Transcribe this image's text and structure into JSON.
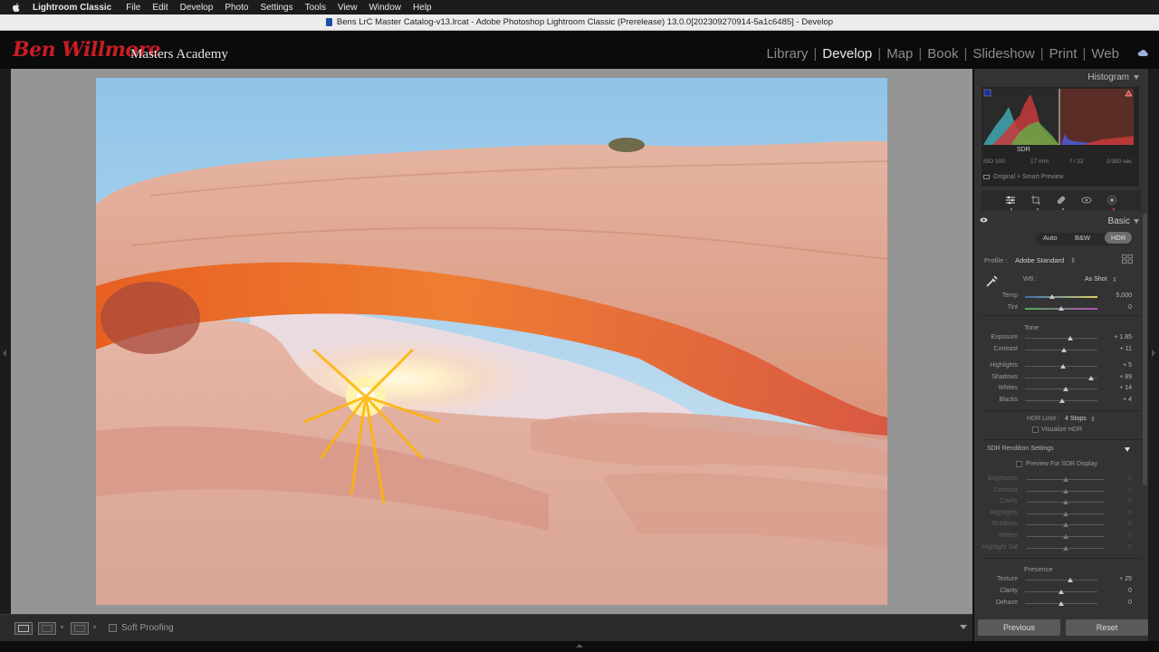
{
  "menubar": {
    "app_name": "Lightroom Classic",
    "items": [
      "File",
      "Edit",
      "Develop",
      "Photo",
      "Settings",
      "Tools",
      "View",
      "Window",
      "Help"
    ]
  },
  "window": {
    "title": "Bens LrC Master Catalog-v13.lrcat - Adobe Photoshop Lightroom Classic (Prerelease) 13.0.0[202309270914-5a1c6485] - Develop"
  },
  "identity": {
    "script": "Ben Willmore",
    "academy": "Masters Academy"
  },
  "modules": [
    {
      "label": "Library",
      "active": false
    },
    {
      "label": "Develop",
      "active": true
    },
    {
      "label": "Map",
      "active": false
    },
    {
      "label": "Book",
      "active": false
    },
    {
      "label": "Slideshow",
      "active": false
    },
    {
      "label": "Print",
      "active": false
    },
    {
      "label": "Web",
      "active": false
    }
  ],
  "toolbar": {
    "soft_proofing": "Soft Proofing"
  },
  "histogram": {
    "title": "Histogram",
    "sdr_label": "SDR",
    "iso": "ISO 100",
    "focal": "17 mm",
    "aperture": "f / 22",
    "shutter": "1/350 sec",
    "preview": "Original + Smart Preview"
  },
  "basic": {
    "title": "Basic",
    "treatments": [
      "Auto",
      "B&W",
      "HDR"
    ],
    "profile_label": "Profile :",
    "profile_value": "Adobe Standard",
    "wb_label": "WB :",
    "wb_value": "As Shot",
    "temp": {
      "label": "Temp",
      "value": "5,000",
      "pos": 0.37
    },
    "tint": {
      "label": "Tint",
      "value": "0",
      "pos": 0.5
    },
    "tone_label": "Tone",
    "tone": [
      {
        "label": "Exposure",
        "value": "+ 1.85",
        "pos": 0.62
      },
      {
        "label": "Contrast",
        "value": "+ 11",
        "pos": 0.54
      },
      {
        "label": "Highlights",
        "value": "+ 5",
        "pos": 0.52
      },
      {
        "label": "Shadows",
        "value": "+ 89",
        "pos": 0.91
      },
      {
        "label": "Whites",
        "value": "+ 14",
        "pos": 0.56
      },
      {
        "label": "Blacks",
        "value": "+ 4",
        "pos": 0.51
      }
    ],
    "hdr_limit_label": "HDR Limit :",
    "hdr_limit_value": "4 Stops",
    "visualize_hdr": "Visualize HDR",
    "sdr_settings": "SDR Rendition Settings",
    "preview_sdr": "Preview For SDR Display",
    "sdr_sliders": [
      {
        "label": "Brightness",
        "value": "0"
      },
      {
        "label": "Contrast",
        "value": "0"
      },
      {
        "label": "Clarity",
        "value": "0"
      },
      {
        "label": "Highlights",
        "value": "0"
      },
      {
        "label": "Shadows",
        "value": "0"
      },
      {
        "label": "Whites",
        "value": "0"
      },
      {
        "label": "Highlight Sat",
        "value": "0"
      }
    ],
    "presence_label": "Presence",
    "presence": [
      {
        "label": "Texture",
        "value": "+ 25",
        "pos": 0.62
      },
      {
        "label": "Clarity",
        "value": "0",
        "pos": 0.5
      },
      {
        "label": "Dehaze",
        "value": "0",
        "pos": 0.5
      }
    ]
  },
  "buttons": {
    "previous": "Previous",
    "reset": "Reset"
  },
  "colors": {
    "accent_red": "#c81d25",
    "panel_bg": "#333333",
    "canvas_bg": "#959595"
  }
}
